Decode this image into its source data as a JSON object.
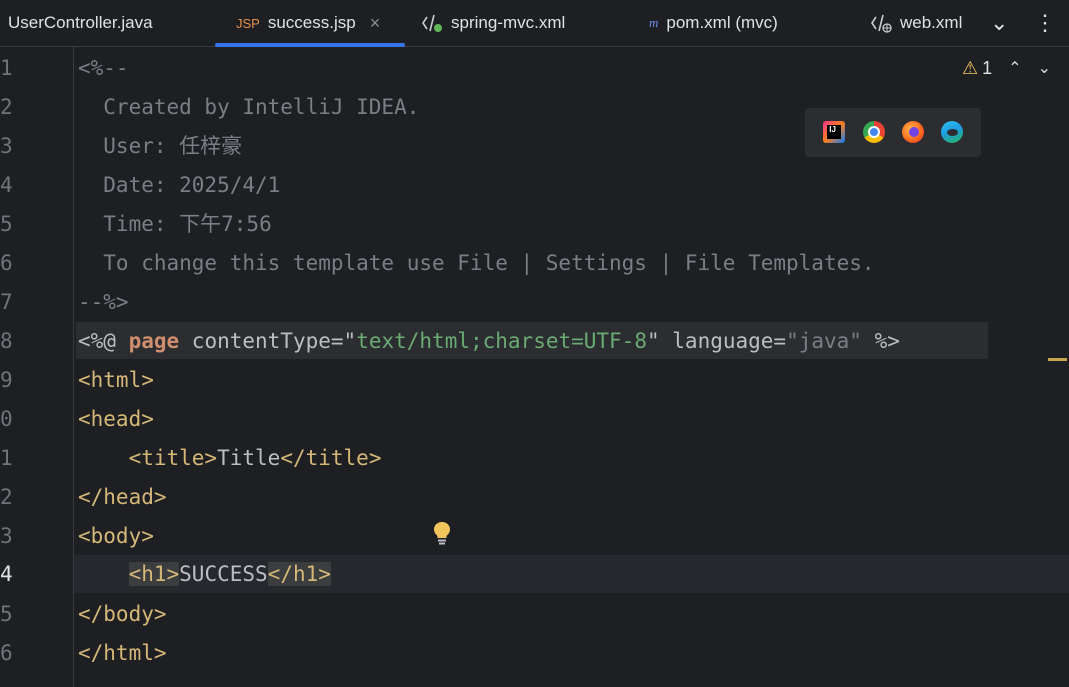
{
  "tabs": [
    {
      "label": "UserController.java",
      "icon": "java-class-icon"
    },
    {
      "label": "success.jsp",
      "icon": "jsp-icon",
      "badge": "JSP",
      "active": true,
      "close": "×"
    },
    {
      "label": "spring-mvc.xml",
      "icon": "spring-xml-icon"
    },
    {
      "label": "pom.xml (mvc)",
      "icon": "maven-icon",
      "icon_text": "m"
    },
    {
      "label": "web.xml",
      "icon": "web-xml-icon"
    }
  ],
  "tab_actions": {
    "more_tabs": "⌄",
    "options": "⋮"
  },
  "inspection": {
    "warnings": "1",
    "warning_icon": "⚠",
    "prev": "⌃",
    "next": "⌄"
  },
  "gutter": {
    "line_numbers": [
      "1",
      "2",
      "3",
      "4",
      "5",
      "6",
      "7",
      "8",
      "9",
      "0",
      "1",
      "2",
      "3",
      "4",
      "5",
      "6"
    ],
    "current_line_index": 13
  },
  "code": {
    "l1": "<%--",
    "l2": "  Created by IntelliJ IDEA.",
    "l3": "  User: 任梓豪",
    "l4": "  Date: 2025/4/1",
    "l5": "  Time: 下午7:56",
    "l6": "  To change this template use File | Settings | File Templates.",
    "l7": "--%>",
    "l8": {
      "open": "<%@ ",
      "kw": "page",
      "sp1": " contentType=",
      "q1": "\"",
      "ct": "text/html;charset=UTF-8",
      "q2": "\"",
      "sp2": " language=",
      "lang": "\"java\"",
      "close": " %>"
    },
    "l9": "<html>",
    "l10": "<head>",
    "l11": {
      "indent": "    ",
      "open": "<title>",
      "text": "Title",
      "close": "</title>"
    },
    "l12": "</head>",
    "l13": "<body>",
    "l14": {
      "indent": "    ",
      "open": "<h1>",
      "text": "SUCCESS",
      "close": "</h1>"
    },
    "l15": "</body>",
    "l16": "</html>"
  },
  "browsers": [
    "intellij-browser-icon",
    "chrome-icon",
    "firefox-icon",
    "edge-icon"
  ],
  "colors": {
    "accent": "#3574f0",
    "warning": "#f2c55c",
    "tag": "#d5b778",
    "string": "#6aab73",
    "keyword": "#cf8e6d",
    "comment": "#7a7e85"
  }
}
